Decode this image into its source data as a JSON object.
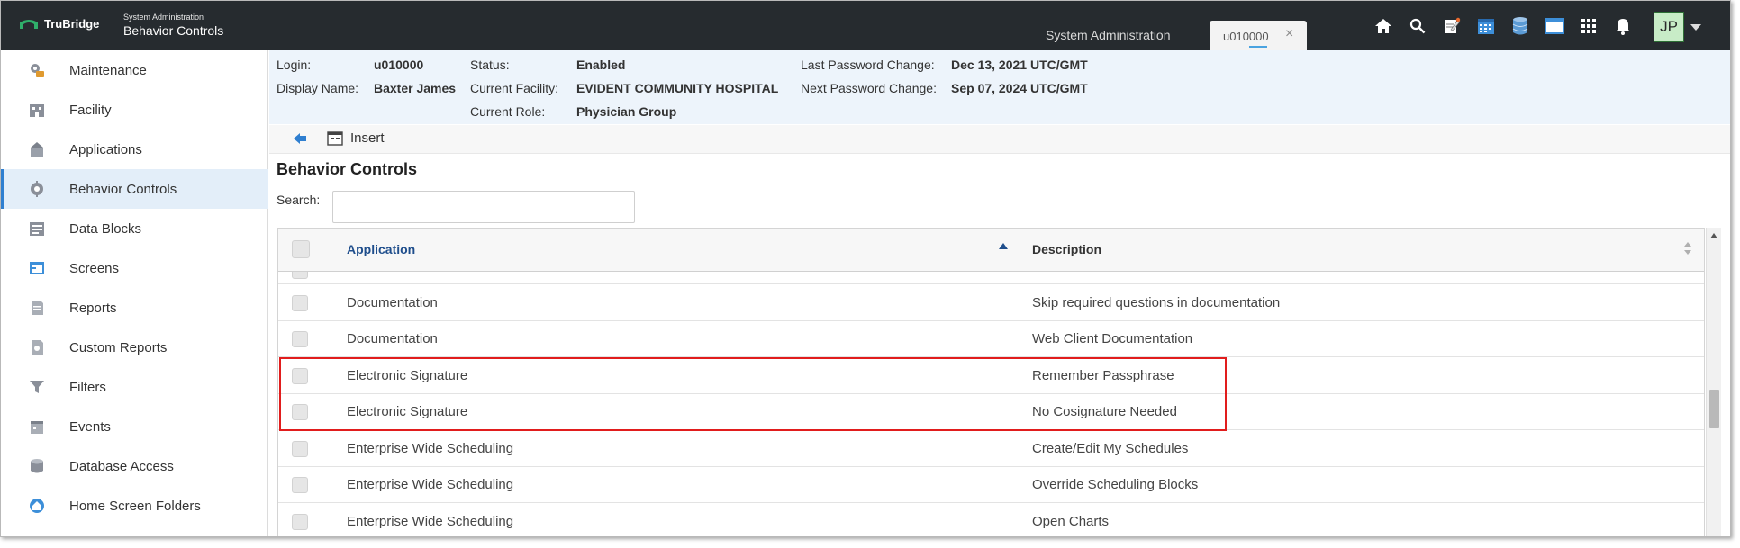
{
  "brand": {
    "logo_text": "TruBridge",
    "app_subtitle": "System Administration",
    "app_title": "Behavior Controls"
  },
  "tabs": {
    "system_admin": "System Administration",
    "active_tab": "u010000",
    "close_glyph": "×"
  },
  "user": {
    "initials": "JP"
  },
  "top_icons": [
    "home-icon",
    "search-icon",
    "notes-icon",
    "calendar-icon",
    "database-icon",
    "window-icon",
    "apps-grid-icon",
    "bell-icon"
  ],
  "sidebar": {
    "items": [
      {
        "label": "Maintenance",
        "icon": "maintenance-icon"
      },
      {
        "label": "Facility",
        "icon": "facility-icon"
      },
      {
        "label": "Applications",
        "icon": "applications-icon"
      },
      {
        "label": "Behavior Controls",
        "icon": "behavior-controls-icon",
        "active": true
      },
      {
        "label": "Data Blocks",
        "icon": "data-blocks-icon"
      },
      {
        "label": "Screens",
        "icon": "screens-icon"
      },
      {
        "label": "Reports",
        "icon": "reports-icon"
      },
      {
        "label": "Custom Reports",
        "icon": "custom-reports-icon"
      },
      {
        "label": "Filters",
        "icon": "filters-icon"
      },
      {
        "label": "Events",
        "icon": "events-icon"
      },
      {
        "label": "Database Access",
        "icon": "database-access-icon"
      },
      {
        "label": "Home Screen Folders",
        "icon": "home-screen-folders-icon"
      }
    ]
  },
  "info": {
    "login_label": "Login:",
    "login_value": "u010000",
    "display_name_label": "Display Name:",
    "display_name_value": "Baxter James",
    "status_label": "Status:",
    "status_value": "Enabled",
    "current_facility_label": "Current Facility:",
    "current_facility_value": "EVIDENT COMMUNITY HOSPITAL",
    "current_role_label": "Current Role:",
    "current_role_value": "Physician Group",
    "last_pw_label": "Last Password Change:",
    "last_pw_value": "Dec 13, 2021 UTC/GMT",
    "next_pw_label": "Next Password Change:",
    "next_pw_value": "Sep 07, 2024 UTC/GMT"
  },
  "toolbar": {
    "insert_label": "Insert"
  },
  "main": {
    "title": "Behavior Controls",
    "search_label": "Search:",
    "search_value": ""
  },
  "grid": {
    "columns": {
      "application": "Application",
      "description": "Description"
    },
    "rows": [
      {
        "application": "Documentation",
        "description": "Skip required questions in documentation"
      },
      {
        "application": "Documentation",
        "description": "Web Client Documentation"
      },
      {
        "application": "Electronic Signature",
        "description": "Remember Passphrase"
      },
      {
        "application": "Electronic Signature",
        "description": "No Cosignature Needed"
      },
      {
        "application": "Enterprise Wide Scheduling",
        "description": "Create/Edit My Schedules"
      },
      {
        "application": "Enterprise Wide Scheduling",
        "description": "Override Scheduling Blocks"
      },
      {
        "application": "Enterprise Wide Scheduling",
        "description": "Open Charts"
      }
    ]
  },
  "colors": {
    "topbar": "#262b2f",
    "accent": "#2f7fd0",
    "highlight": "#e11d1d",
    "header_link": "#1f4e8c"
  }
}
